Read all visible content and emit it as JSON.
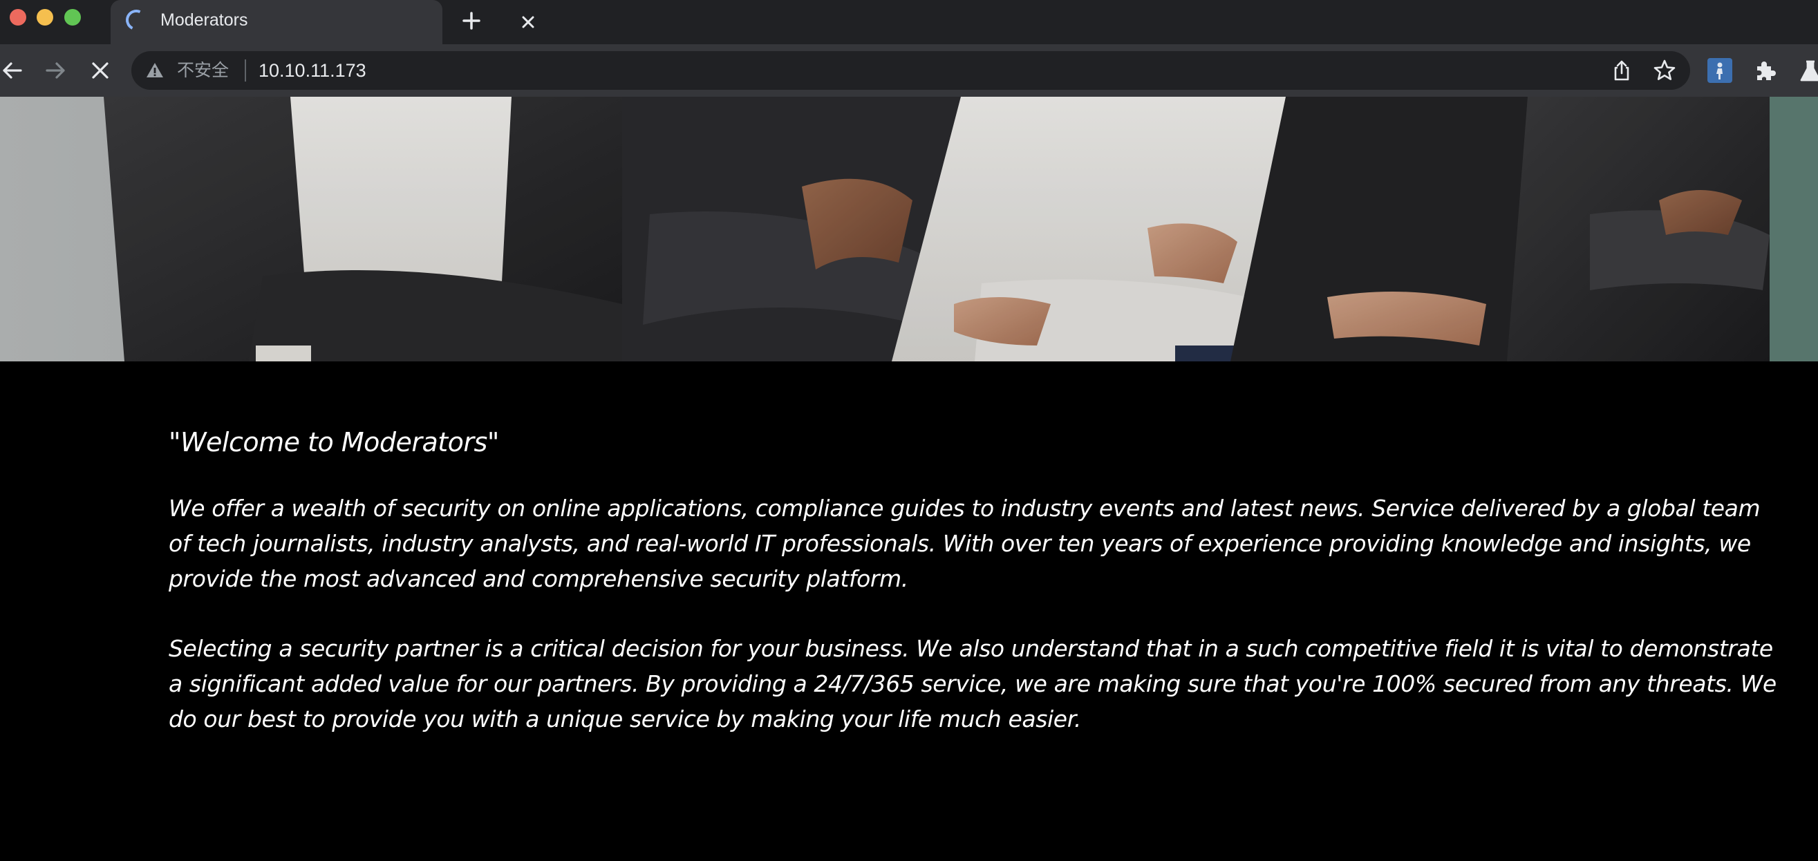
{
  "browser": {
    "tab": {
      "title": "Moderators"
    },
    "toolbar": {
      "security_label": "不安全",
      "url": "10.10.11.173"
    }
  },
  "page": {
    "hero_image": "team-arms-crossed-photo",
    "welcome_heading": "\"Welcome to Moderators\"",
    "paragraphs": [
      "We offer a wealth of security on online applications, compliance guides to industry events and latest news. Service delivered by a global team of tech journalists, industry analysts, and real-world IT professionals. With over ten years of experience providing knowledge and insights, we provide the most advanced and comprehensive security platform.",
      "Selecting a security partner is a critical decision for your business. We also understand that in a such competitive field it is vital to demonstrate a significant added value for our partners. By providing a 24/7/365 service, we are making sure that you're 100% secured from any threats. We do our best to provide you with a unique service by making your life much easier."
    ]
  },
  "colors": {
    "tabstrip_bg": "#202124",
    "toolbar_bg": "#35363a",
    "page_bg": "#000000",
    "text": "#ffffff",
    "spinner": "#8ab4f8"
  },
  "icons": [
    "loading-spinner-icon",
    "close-icon",
    "plus-icon",
    "back-arrow-icon",
    "forward-arrow-icon",
    "stop-icon",
    "warning-icon",
    "share-icon",
    "star-icon",
    "extension-icon",
    "puzzle-icon",
    "lab-flask-icon"
  ]
}
